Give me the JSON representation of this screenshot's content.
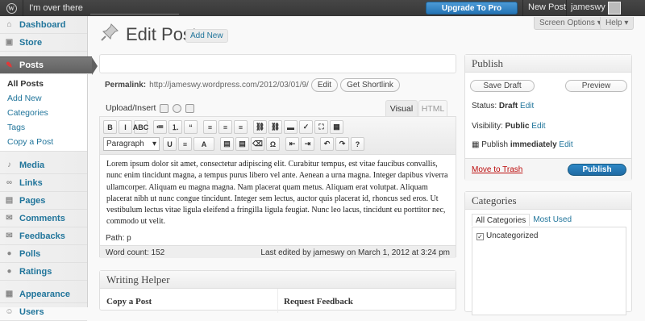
{
  "adminbar": {
    "wp_logo": "W",
    "site_name": "I'm over there",
    "upgrade": "Upgrade To Pro",
    "new_post": "New Post",
    "user": "jameswy"
  },
  "sidebar": {
    "items_top": [
      {
        "label": "Dashboard",
        "icon": "dashboard-icon",
        "glyph": "⌂"
      },
      {
        "label": "Store",
        "icon": "store-icon",
        "glyph": "▣"
      }
    ],
    "active": {
      "label": "Posts",
      "icon": "pushpin-icon",
      "glyph": "✎"
    },
    "submenu": [
      "All Posts",
      "Add New",
      "Categories",
      "Tags",
      "Copy a Post"
    ],
    "items_bottom": [
      {
        "label": "Media",
        "icon": "media-icon",
        "glyph": "♪"
      },
      {
        "label": "Links",
        "icon": "links-icon",
        "glyph": "∞"
      },
      {
        "label": "Pages",
        "icon": "pages-icon",
        "glyph": "▤"
      },
      {
        "label": "Comments",
        "icon": "comments-icon",
        "glyph": "✉"
      },
      {
        "label": "Feedbacks",
        "icon": "feedbacks-icon",
        "glyph": "✉"
      },
      {
        "label": "Polls",
        "icon": "polls-icon",
        "glyph": "●"
      },
      {
        "label": "Ratings",
        "icon": "ratings-icon",
        "glyph": "●"
      }
    ],
    "items_bottom2": [
      {
        "label": "Appearance",
        "icon": "appearance-icon",
        "glyph": "▦"
      },
      {
        "label": "Users",
        "icon": "users-icon",
        "glyph": "☺"
      }
    ]
  },
  "header": {
    "screen_options": "Screen Options ▾",
    "help": "Help ▾",
    "title": "Edit Post",
    "add_new": "Add New"
  },
  "post": {
    "title_value": "",
    "permalink_label": "Permalink:",
    "permalink_url": "http://jameswy.wordpress.com/2012/03/01/9/",
    "edit_btn": "Edit",
    "shortlink_btn": "Get Shortlink",
    "upload_label": "Upload/Insert",
    "tab_visual": "Visual",
    "tab_html": "HTML",
    "format_select": "Paragraph",
    "content": "Lorem ipsum dolor sit amet, consectetur adipiscing elit. Curabitur tempus, est vitae faucibus convallis, nunc enim tincidunt magna, a tempus purus libero vel ante. Aenean a urna magna. Integer dapibus viverra ullamcorper. Aliquam eu magna magna. Nam placerat quam metus. Aliquam erat volutpat. Aliquam placerat nibh ut nunc congue tincidunt. Integer sem lectus, auctor quis placerat id, rhoncus sed eros. Ut vestibulum lectus vitae ligula eleifend a fringilla ligula feugiat. Nunc leo lacus, tincidunt eu porttitor nec, commodo ut velit.",
    "path": "Path: p",
    "word_count": "Word count: 152",
    "last_edited": "Last edited by jameswy on March 1, 2012 at 3:24 pm"
  },
  "toolbar_row1": [
    "B",
    "I",
    "ABC",
    "≔",
    "⒈",
    "“",
    "≡",
    "≡",
    "≡",
    "⛓",
    "⛓",
    "▬",
    "✓",
    "⛶",
    "▦"
  ],
  "toolbar_row2": [
    "U",
    "≡",
    "A",
    "▤",
    "▤",
    "⌫",
    "Ω",
    "⇤",
    "⇥",
    "↶",
    "↷",
    "?"
  ],
  "writing_helper": {
    "title": "Writing Helper",
    "col1": "Copy a Post",
    "col2": "Request Feedback"
  },
  "publish": {
    "title": "Publish",
    "save_draft": "Save Draft",
    "preview": "Preview",
    "status_label": "Status:",
    "status_value": "Draft",
    "visibility_label": "Visibility:",
    "visibility_value": "Public",
    "publish_label": "Publish",
    "publish_value": "immediately",
    "edit": "Edit",
    "trash": "Move to Trash",
    "publish_btn": "Publish"
  },
  "categories": {
    "title": "Categories",
    "tab_all": "All Categories",
    "tab_used": "Most Used",
    "items": [
      {
        "label": "Uncategorized",
        "checked": true
      }
    ]
  }
}
